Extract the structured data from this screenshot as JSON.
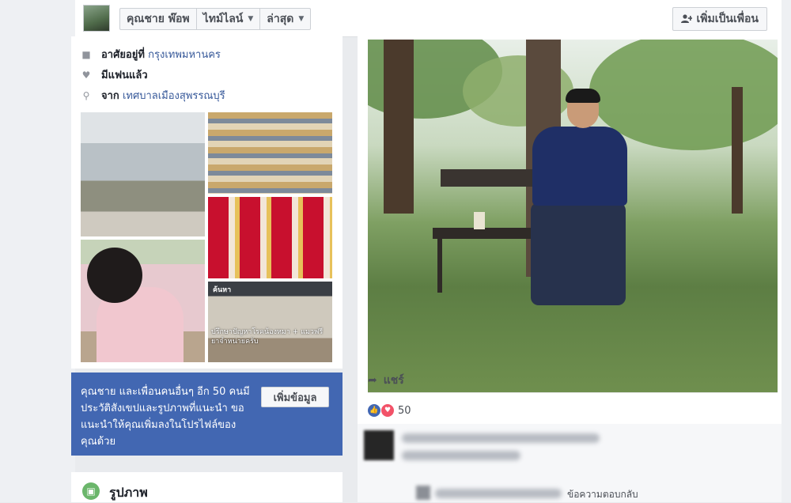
{
  "header": {
    "profile_name": "คุณชาย พ๊อพ",
    "timeline_label": "ไทม์ไลน์",
    "recent_label": "ล่าสุด",
    "add_friend_label": "เพิ่มเป็นเพื่อน",
    "add_friend_icon": "person-plus-icon"
  },
  "intro": {
    "lives_label": "อาศัยอยู่ที่",
    "lives_value": "กรุงเทพมหานคร",
    "relationship": "มีแฟนแล้ว",
    "from_label": "จาก",
    "from_value": "เทศบาลเมืองสุพรรณบุรี"
  },
  "photo_grid": {
    "tile5_title": "ค้นหา",
    "tile5_caption": "ปรึกษาปัญหาโรคน้องหมา + แมวฟรี ยาจำหน่ายครับ"
  },
  "suggest_card": {
    "text": "คุณชาย และเพื่อนคนอื่นๆ อีก 50 คนมีประวัติสังเขปและรูปภาพที่แนะนำ ขอแนะนำให้คุณเพิ่มลงในโปรไฟล์ของคุณด้วย",
    "button": "เพิ่มข้อมูล",
    "bg_color": "#4267b2"
  },
  "photos_section": {
    "title": "รูปภาพ"
  },
  "post": {
    "share_label": "แชร์",
    "reaction_count": "50",
    "reply_label": "ข้อความตอบกลับ"
  }
}
